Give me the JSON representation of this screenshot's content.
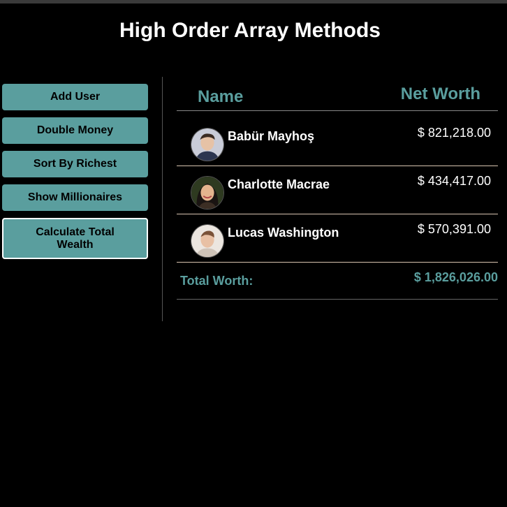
{
  "title": "High Order Array Methods",
  "buttons": {
    "add_user": "Add User",
    "double_money": "Double Money",
    "sort_richest": "Sort By Richest",
    "show_millionaires": "Show Millionaires",
    "calculate_total": "Calculate Total Wealth"
  },
  "table": {
    "header_name": "Name",
    "header_worth": "Net Worth",
    "rows": [
      {
        "name": "Babür Mayhoş",
        "worth": "$ 821,218.00",
        "avatar": "avatar-photo"
      },
      {
        "name": "Charlotte Macrae",
        "worth": "$ 434,417.00",
        "avatar": "avatar-photo"
      },
      {
        "name": "Lucas Washington",
        "worth": "$ 570,391.00",
        "avatar": "avatar-photo"
      }
    ],
    "total_label": "Total Worth:",
    "total_value": "$ 1,826,026.00"
  },
  "colors": {
    "accent": "#5a9e9e",
    "background": "#000000",
    "row_divider": "#d8c4b0",
    "header_divider": "#888888"
  }
}
